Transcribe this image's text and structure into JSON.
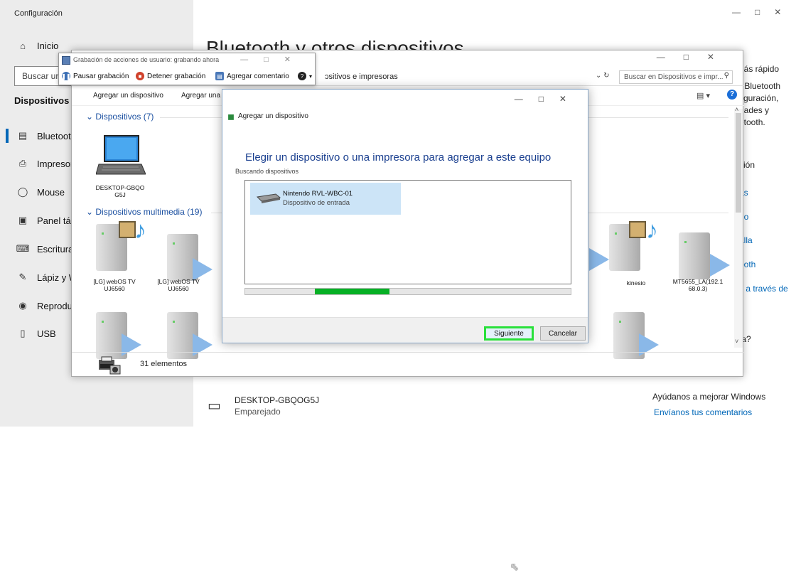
{
  "settings": {
    "window_title": "Configuración",
    "search_placeholder": "Buscar ur",
    "section_header": "Dispositivos",
    "main_heading": "Bluetooth y otros dispositivos",
    "sidebar_items": [
      {
        "label": "Inicio",
        "icon": "home-icon"
      },
      {
        "label": "Bluetooth y c",
        "icon": "bluetooth-devices-icon"
      },
      {
        "label": "Impresoras y",
        "icon": "printer-icon"
      },
      {
        "label": "Mouse",
        "icon": "mouse-icon"
      },
      {
        "label": "Panel táctil",
        "icon": "touchpad-icon"
      },
      {
        "label": "Escritura",
        "icon": "keyboard-icon"
      },
      {
        "label": "Lápiz y Wind",
        "icon": "pen-icon"
      },
      {
        "label": "Reproducción",
        "icon": "autoplay-icon"
      },
      {
        "label": "USB",
        "icon": "usb-icon"
      }
    ],
    "right_panel": {
      "faster_text": "nás rápido",
      "bt_line1": "r Bluetooth",
      "bt_line2": "figuración,",
      "bt_line3": "dades y",
      "bt_line4": "etooth.",
      "related": "ción",
      "link1": "as",
      "link2": "do",
      "link3": "alla",
      "link4": "ooth",
      "link5": "s a través de",
      "question": "ta?"
    },
    "bottom_device": {
      "name": "DESKTOP-GBQOG5J",
      "status": "Emparejado"
    },
    "help_text": "Ayúdanos a mejorar Windows",
    "feedback_link": "Envíanos tus comentarios"
  },
  "explorer": {
    "address": "ɔsitivos e impresoras",
    "search_placeholder": "Buscar en Dispositivos e impr...",
    "toolbar": [
      "Agregar un dispositivo",
      "Agregar una"
    ],
    "groups": [
      {
        "title": "Dispositivos (7)"
      },
      {
        "title": "Dispositivos multimedia (19)"
      }
    ],
    "devices": {
      "laptop": "DESKTOP-GBQO G5J",
      "media1": "[LG] webOS TV UJ6560",
      "media2": "[LG] webOS TV UJ6560",
      "media3": "kinesio",
      "media4": "MT5655_LA(192.1 68.0.3)"
    },
    "status_count": "31 elementos"
  },
  "dialog": {
    "title": "Agregar un dispositivo",
    "heading": "Elegir un dispositivo o una impresora para agregar a este equipo",
    "subheading": "Buscando dispositivos",
    "item_name": "Nintendo RVL-WBC-01",
    "item_type": "Dispositivo de entrada",
    "progress": 0.23,
    "next_button": "Siguiente",
    "cancel_button": "Cancelar"
  },
  "recorder": {
    "title": "Grabación de acciones de usuario: grabando ahora",
    "pause": "Pausar grabación",
    "stop": "Detener grabación",
    "add_comment": "Agregar comentario"
  },
  "colors": {
    "accent": "#0067b8",
    "progress": "#06b025",
    "highlight": "#29e03a"
  }
}
